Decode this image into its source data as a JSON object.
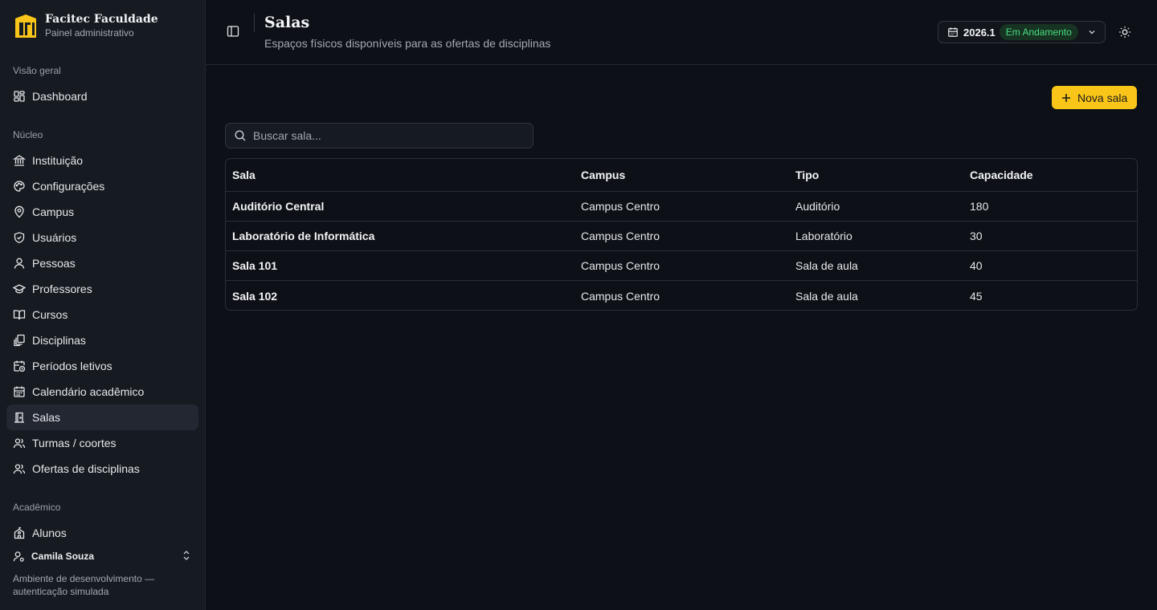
{
  "brand": {
    "name": "Facitec Faculdade",
    "subtitle": "Painel administrativo"
  },
  "sidebar": {
    "groups": {
      "overview": "Visão geral",
      "core": "Núcleo",
      "academic": "Acadêmico"
    },
    "items": [
      {
        "label": "Dashboard",
        "icon": "dashboard-icon"
      },
      {
        "label": "Instituição",
        "icon": "landmark-icon"
      },
      {
        "label": "Configurações",
        "icon": "palette-icon"
      },
      {
        "label": "Campus",
        "icon": "map-pin-icon"
      },
      {
        "label": "Usuários",
        "icon": "shield-icon"
      },
      {
        "label": "Pessoas",
        "icon": "user-icon"
      },
      {
        "label": "Professores",
        "icon": "graduation-cap-icon"
      },
      {
        "label": "Cursos",
        "icon": "book-open-icon"
      },
      {
        "label": "Disciplinas",
        "icon": "library-icon"
      },
      {
        "label": "Períodos letivos",
        "icon": "calendar-clock-icon"
      },
      {
        "label": "Calendário acadêmico",
        "icon": "calendar-icon"
      },
      {
        "label": "Salas",
        "icon": "door-icon",
        "active": true
      },
      {
        "label": "Turmas / coortes",
        "icon": "users-icon"
      },
      {
        "label": "Ofertas de disciplinas",
        "icon": "users-icon"
      },
      {
        "label": "Alunos",
        "icon": "school-icon"
      }
    ],
    "user": {
      "name": "Camila Souza"
    },
    "env_note": "Ambiente de desenvolvimento — autenticação simulada"
  },
  "header": {
    "title": "Salas",
    "subtitle": "Espaços físicos disponíveis para as ofertas de disciplinas",
    "period": {
      "year": "2026.1",
      "status": "Em Andamento"
    }
  },
  "actions": {
    "add_label": "Nova sala"
  },
  "search": {
    "placeholder": "Buscar sala..."
  },
  "table": {
    "columns": [
      "Sala",
      "Campus",
      "Tipo",
      "Capacidade"
    ],
    "rows": [
      [
        "Auditório Central",
        "Campus Centro",
        "Auditório",
        "180"
      ],
      [
        "Laboratório de Informática",
        "Campus Centro",
        "Laboratório",
        "30"
      ],
      [
        "Sala 101",
        "Campus Centro",
        "Sala de aula",
        "40"
      ],
      [
        "Sala 102",
        "Campus Centro",
        "Sala de aula",
        "45"
      ]
    ]
  },
  "colors": {
    "accent": "#f9c519",
    "background": "#0d1016",
    "sidebar": "#161a21",
    "status_badge_text": "#4ade80"
  }
}
